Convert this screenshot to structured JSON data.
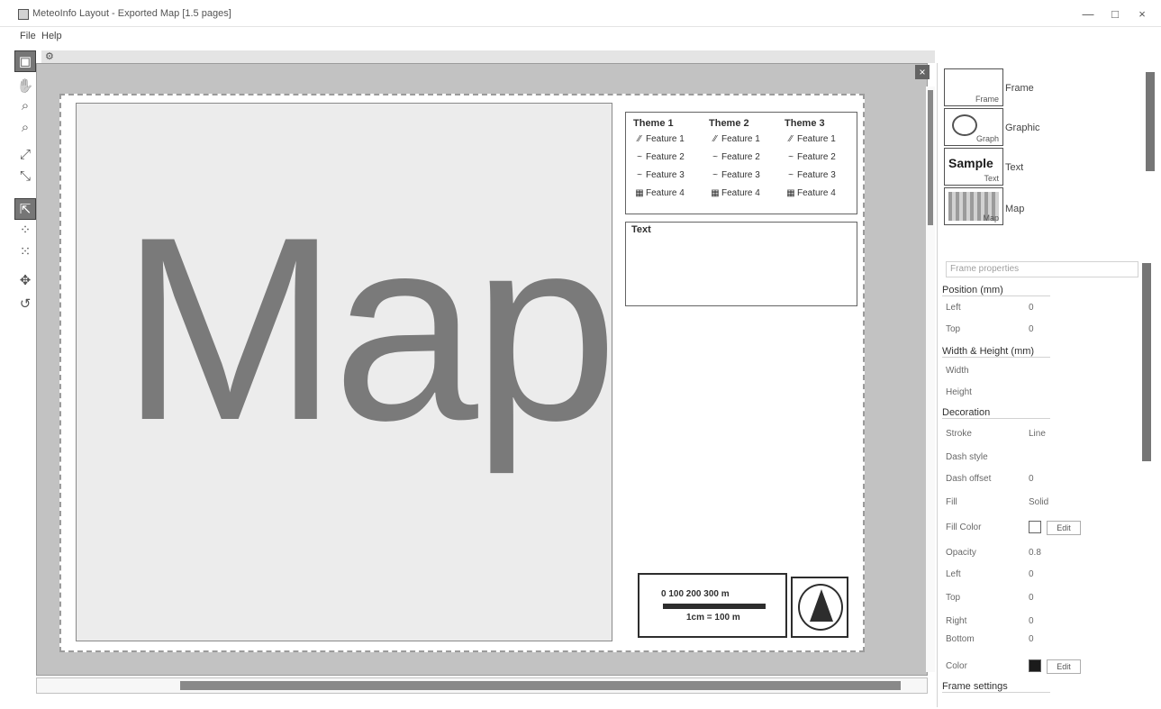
{
  "window": {
    "title": "MeteoInfo Layout - Exported Map [1.5 pages]",
    "minimize": "—",
    "maximize": "□",
    "close": "×"
  },
  "menu": {
    "items": [
      "File",
      "Help"
    ]
  },
  "toolbar": {
    "tools": [
      "select",
      "zoom-in",
      "zoom-out",
      "pan",
      "full-extent",
      "select-elements",
      "new-text",
      "resize",
      "rotate",
      "undo"
    ]
  },
  "canvas": {
    "close_label": "×",
    "map_text": "Map",
    "legend": {
      "columns": [
        {
          "title": "Theme 1",
          "rows": [
            {
              "symbol": "⁄⁄",
              "label": "Feature 1"
            },
            {
              "symbol": "~",
              "label": "Feature 2"
            },
            {
              "symbol": "~",
              "label": "Feature 3"
            },
            {
              "symbol": "▦",
              "label": "Feature 4"
            }
          ]
        },
        {
          "title": "Theme 2",
          "rows": [
            {
              "symbol": "⁄⁄",
              "label": "Feature 1"
            },
            {
              "symbol": "~",
              "label": "Feature 2"
            },
            {
              "symbol": "~",
              "label": "Feature 3"
            },
            {
              "symbol": "▦",
              "label": "Feature 4"
            }
          ]
        },
        {
          "title": "Theme 3",
          "rows": [
            {
              "symbol": "⁄⁄",
              "label": "Feature 1"
            },
            {
              "symbol": "~",
              "label": "Feature 2"
            },
            {
              "symbol": "~",
              "label": "Feature 3"
            },
            {
              "symbol": "▦",
              "label": "Feature 4"
            }
          ]
        }
      ]
    },
    "text_box": "Text",
    "scalebar": {
      "ticks": "0   100   200   300 m",
      "caption": "1cm = 100 m"
    }
  },
  "right_panel": {
    "items": [
      {
        "caption": "Frame",
        "label": "Frame"
      },
      {
        "caption": "Graph",
        "label": "Graphic"
      },
      {
        "caption": "Text",
        "label": "Text",
        "sample": "Sample"
      },
      {
        "caption": "Map",
        "label": "Map"
      }
    ],
    "properties": {
      "selector": "Frame properties",
      "groups": [
        "Position (mm)",
        "Width & Height (mm)",
        "Decoration",
        "Frame settings"
      ],
      "fields": [
        {
          "label": "Left",
          "value": "0"
        },
        {
          "label": "Top",
          "value": "0"
        },
        {
          "label": "Width",
          "value": ""
        },
        {
          "label": "Height",
          "value": ""
        },
        {
          "label": "Stroke",
          "value": "Line"
        },
        {
          "label": "Dash style",
          "value": ""
        },
        {
          "label": "Dash offset",
          "value": "0"
        },
        {
          "label": "Fill",
          "value": "Solid"
        },
        {
          "label": "Fill Color",
          "value": ""
        },
        {
          "label": "Opacity",
          "value": "0.8"
        },
        {
          "label": "Left",
          "value": "0"
        },
        {
          "label": "Top",
          "value": "0"
        },
        {
          "label": "Right",
          "value": "0"
        },
        {
          "label": "Bottom",
          "value": "0"
        },
        {
          "label": "Color",
          "value": ""
        }
      ],
      "button_label": "Edit"
    }
  },
  "colors": {
    "canvas_bg": "#bdbdbd",
    "map_fill": "#e4e4e4",
    "map_text": "#7a7a7a",
    "stroke_swatch": "#222222"
  }
}
